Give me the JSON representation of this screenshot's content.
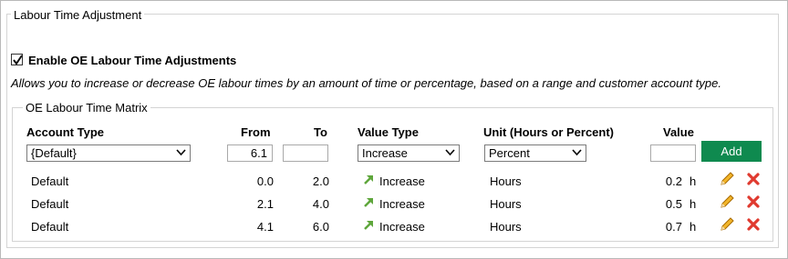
{
  "section": {
    "title": "Labour Time Adjustment"
  },
  "enable": {
    "checked": true,
    "label": "Enable OE Labour Time Adjustments",
    "description": "Allows you to increase or decrease OE labour times by an amount of time or percentage, based on a range and customer account type."
  },
  "matrix": {
    "title": "OE Labour Time Matrix",
    "headers": {
      "account_type": "Account Type",
      "from": "From",
      "to": "To",
      "value_type": "Value Type",
      "unit": "Unit (Hours or Percent)",
      "value": "Value"
    },
    "form": {
      "account_type": "{Default}",
      "from": "6.1",
      "to": "",
      "value_type": "Increase",
      "unit": "Percent",
      "value": "",
      "add_label": "Add"
    },
    "rows": [
      {
        "account": "Default",
        "from": "0.0",
        "to": "2.0",
        "value_type": "Increase",
        "unit": "Hours",
        "value": "0.2",
        "suffix": "h"
      },
      {
        "account": "Default",
        "from": "2.1",
        "to": "4.0",
        "value_type": "Increase",
        "unit": "Hours",
        "value": "0.5",
        "suffix": "h"
      },
      {
        "account": "Default",
        "from": "4.1",
        "to": "6.0",
        "value_type": "Increase",
        "unit": "Hours",
        "value": "0.7",
        "suffix": "h"
      }
    ],
    "icons": {
      "increase": "increase-arrow-icon",
      "edit": "pencil-icon",
      "delete": "delete-x-icon"
    }
  },
  "colors": {
    "add_button": "#0f8a4f",
    "increase_arrow": "#5ea63b",
    "delete": "#e03a2f",
    "pencil": "#e8a317"
  }
}
